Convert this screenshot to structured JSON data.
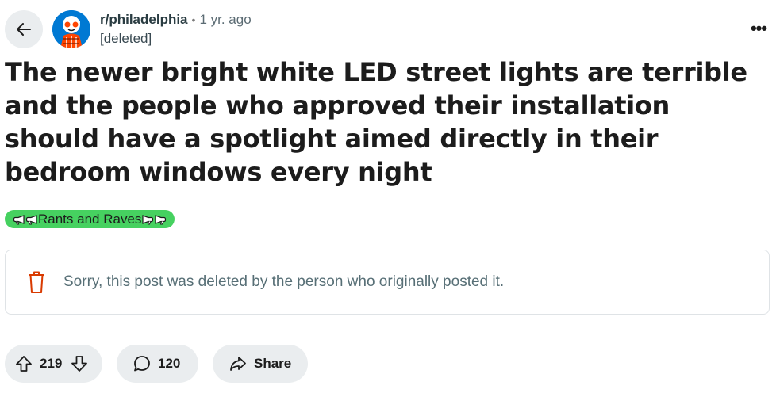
{
  "header": {
    "subreddit": "r/philadelphia",
    "separator": "•",
    "age": "1 yr. ago",
    "author": "[deleted]",
    "more_label": "•••"
  },
  "post": {
    "title": "The newer bright white LED street lights are terrible and the people who approved their installation should have a spotlight aimed directly in their bedroom windows every night",
    "flair": {
      "text": "Rants and Raves",
      "color": "#46d160"
    },
    "deleted_notice": "Sorry, this post was deleted by the person who originally posted it."
  },
  "actions": {
    "votes": "219",
    "comments": "120",
    "share_label": "Share"
  },
  "icons": {
    "back": "back-arrow-icon",
    "avatar": "subreddit-avatar-icon",
    "more": "overflow-menu-icon",
    "flair": "megaphone-icon",
    "trash": "trash-icon",
    "upvote": "upvote-arrow-icon",
    "downvote": "downvote-arrow-icon",
    "comment": "comment-bubble-icon",
    "share": "share-arrow-icon"
  },
  "colors": {
    "button_bg": "#eaedef",
    "deleted_icon": "#d93a00",
    "muted_text": "#576f76"
  }
}
